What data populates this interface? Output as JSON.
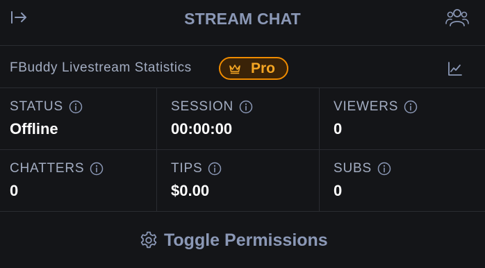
{
  "header": {
    "title": "STREAM CHAT",
    "collapse_icon": "arrow-right-to-line-icon",
    "users_icon": "users-icon"
  },
  "stats": {
    "title": "FBuddy Livestream Statistics",
    "badge": {
      "label": "Pro",
      "icon": "crown-icon",
      "color": "#f08c00"
    },
    "chart_icon": "chart-line-icon",
    "cells": [
      {
        "label": "STATUS",
        "value": "Offline"
      },
      {
        "label": "SESSION",
        "value": "00:00:00"
      },
      {
        "label": "VIEWERS",
        "value": "0"
      },
      {
        "label": "CHATTERS",
        "value": "0"
      },
      {
        "label": "TIPS",
        "value": "$0.00"
      },
      {
        "label": "SUBS",
        "value": "0"
      }
    ]
  },
  "footer": {
    "toggle_label": "Toggle Permissions",
    "toggle_icon": "gear-icon"
  },
  "colors": {
    "background": "#141518",
    "muted_text": "#8b98b6",
    "label_text": "#a3adc2",
    "accent": "#f08c00"
  }
}
